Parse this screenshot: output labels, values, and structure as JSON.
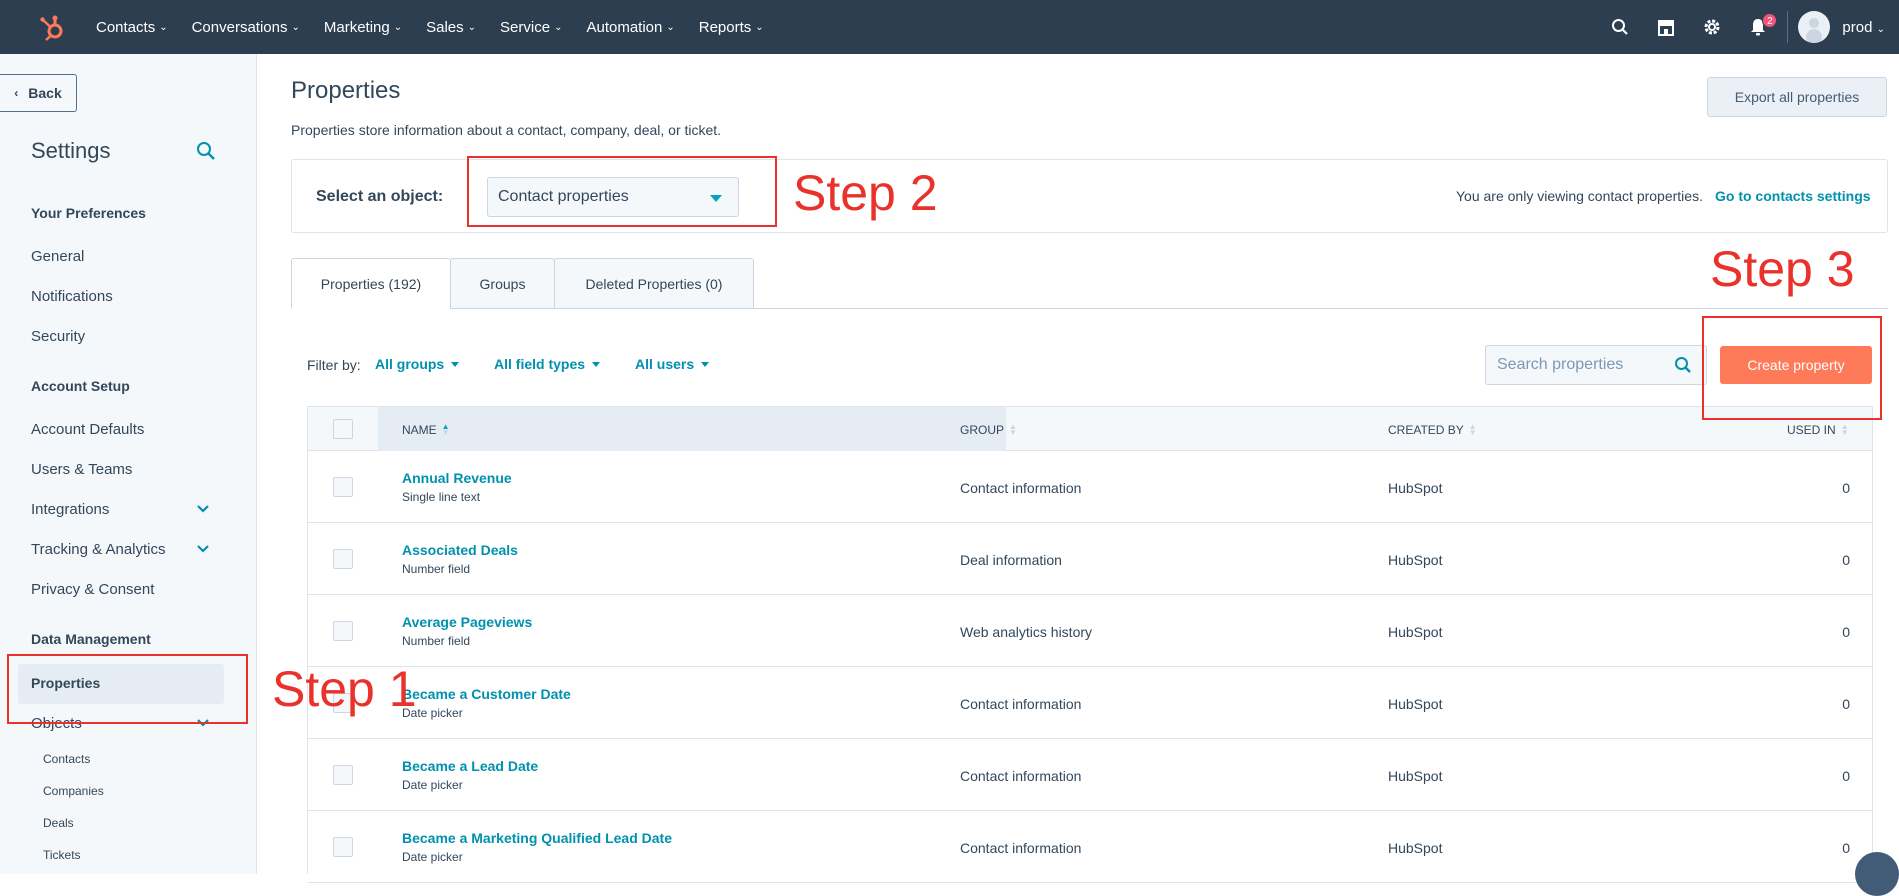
{
  "topnav": {
    "items": [
      {
        "label": "Contacts"
      },
      {
        "label": "Conversations"
      },
      {
        "label": "Marketing"
      },
      {
        "label": "Sales"
      },
      {
        "label": "Service"
      },
      {
        "label": "Automation"
      },
      {
        "label": "Reports"
      }
    ],
    "notification_count": "2",
    "username": "prod"
  },
  "sidebar": {
    "back_label": "Back",
    "title": "Settings",
    "sections": {
      "your_preferences": "Your Preferences",
      "account_setup": "Account Setup",
      "data_management": "Data Management"
    },
    "items": {
      "general": "General",
      "notifications": "Notifications",
      "security": "Security",
      "account_defaults": "Account Defaults",
      "users_teams": "Users & Teams",
      "integrations": "Integrations",
      "tracking": "Tracking & Analytics",
      "privacy": "Privacy & Consent",
      "properties": "Properties",
      "objects": "Objects"
    },
    "subitems": {
      "contacts": "Contacts",
      "companies": "Companies",
      "deals": "Deals",
      "tickets": "Tickets"
    }
  },
  "main": {
    "title": "Properties",
    "description": "Properties store information about a contact, company, deal, or ticket.",
    "export_label": "Export all properties",
    "select_label": "Select an object:",
    "select_value": "Contact properties",
    "object_note": "You are only viewing contact properties.",
    "object_link": "Go to contacts settings",
    "tabs": [
      {
        "label": "Properties (192)"
      },
      {
        "label": "Groups"
      },
      {
        "label": "Deleted Properties (0)"
      }
    ],
    "filter_label": "Filter by:",
    "filters": {
      "groups": "All groups",
      "field_types": "All field types",
      "users": "All users"
    },
    "search_placeholder": "Search properties",
    "create_label": "Create property"
  },
  "table": {
    "headers": {
      "name": "NAME",
      "group": "GROUP",
      "created_by": "CREATED BY",
      "used_in": "USED IN"
    },
    "rows": [
      {
        "name": "Annual Revenue",
        "type": "Single line text",
        "group": "Contact information",
        "created_by": "HubSpot",
        "used_in": "0"
      },
      {
        "name": "Associated Deals",
        "type": "Number field",
        "group": "Deal information",
        "created_by": "HubSpot",
        "used_in": "0"
      },
      {
        "name": "Average Pageviews",
        "type": "Number field",
        "group": "Web analytics history",
        "created_by": "HubSpot",
        "used_in": "0"
      },
      {
        "name": "Became a Customer Date",
        "type": "Date picker",
        "group": "Contact information",
        "created_by": "HubSpot",
        "used_in": "0"
      },
      {
        "name": "Became a Lead Date",
        "type": "Date picker",
        "group": "Contact information",
        "created_by": "HubSpot",
        "used_in": "0"
      },
      {
        "name": "Became a Marketing Qualified Lead Date",
        "type": "Date picker",
        "group": "Contact information",
        "created_by": "HubSpot",
        "used_in": "0"
      }
    ]
  },
  "annotations": {
    "step1": "Step 1",
    "step2": "Step 2",
    "step3": "Step 3"
  },
  "colors": {
    "nav_bg": "#2d3e50",
    "accent": "#0091ae",
    "cta": "#ff7a59",
    "annotation": "#e8322b"
  }
}
